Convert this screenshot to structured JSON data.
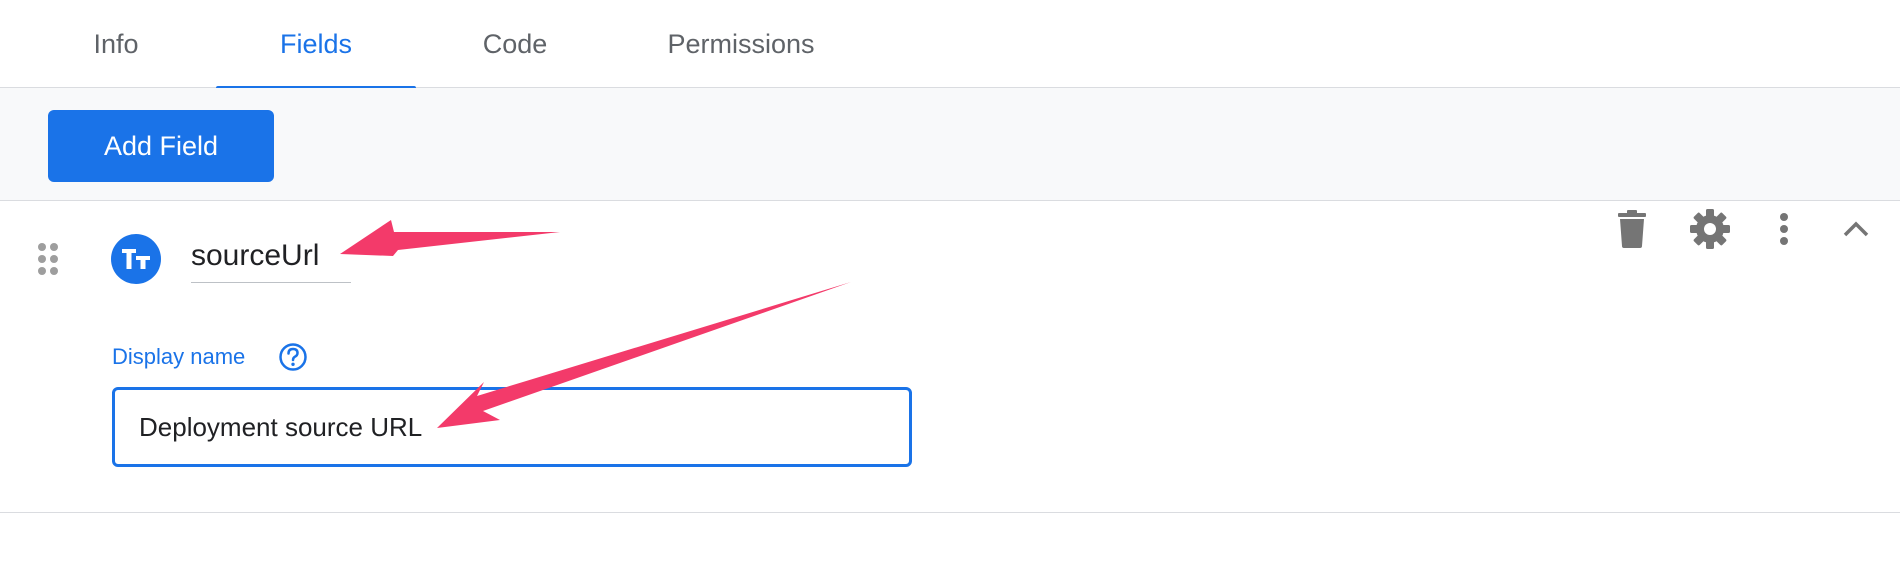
{
  "tabs": [
    {
      "label": "Info",
      "active": false
    },
    {
      "label": "Fields",
      "active": true
    },
    {
      "label": "Code",
      "active": false
    },
    {
      "label": "Permissions",
      "active": false
    }
  ],
  "toolbar": {
    "add_field_label": "Add Field"
  },
  "field": {
    "type_icon": "text-type-icon",
    "id_value": "sourceUrl",
    "display_name_label": "Display name",
    "display_name_value": "Deployment source URL",
    "actions": [
      "delete-icon",
      "settings-icon",
      "more-vert-icon",
      "chevron-up-icon"
    ]
  },
  "colors": {
    "accent": "#1a73e8",
    "annotation_arrow": "#f33a6a",
    "icon_gray": "#757575"
  }
}
